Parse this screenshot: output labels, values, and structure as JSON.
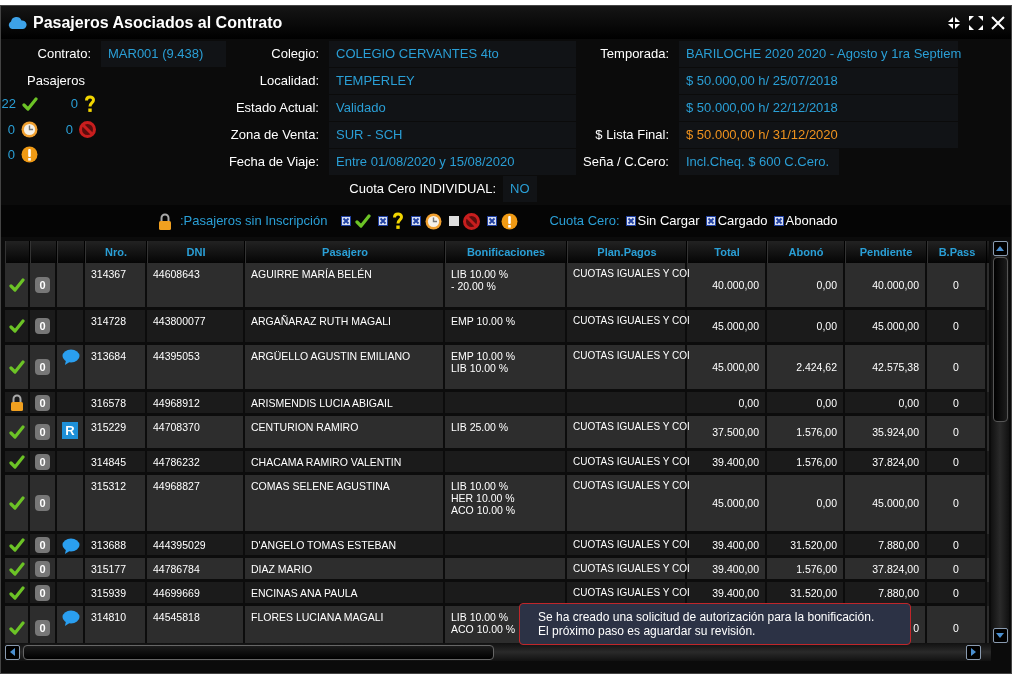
{
  "window": {
    "title": "Pasajeros Asociados al Contrato"
  },
  "contract": {
    "label": "Contrato:",
    "value": "MAR001 (9.438)"
  },
  "passenger_counts": {
    "title": "Pasajeros",
    "items": [
      {
        "kind": "ok",
        "count": "22"
      },
      {
        "kind": "pending",
        "count": "0"
      },
      {
        "kind": "waiting",
        "count": "0"
      },
      {
        "kind": "blocked",
        "count": "0"
      },
      {
        "kind": "alert",
        "count": "0"
      }
    ]
  },
  "info_middle": [
    {
      "label": "Colegio:",
      "value": "COLEGIO CERVANTES 4to"
    },
    {
      "label": "Localidad:",
      "value": "TEMPERLEY"
    },
    {
      "label": "Estado Actual:",
      "value": "Validado"
    },
    {
      "label": "Zona de Venta:",
      "value": "SUR - SCH"
    },
    {
      "label": "Fecha de Viaje:",
      "value": "Entre 01/08/2020 y 15/08/2020"
    }
  ],
  "info_right": [
    {
      "label": "Temporada:",
      "value": "BARILOCHE 2020 2020 - Agosto y 1ra Septiem",
      "highlight": false
    },
    {
      "value": "$ 50.000,00 h/ 25/07/2018",
      "highlight": false
    },
    {
      "value": "$ 50.000,00 h/ 22/12/2018",
      "highlight": false
    },
    {
      "label": "$ Lista Final:",
      "value": "$ 50.000,00 h/ 31/12/2020",
      "highlight": true
    },
    {
      "label": "Seña / C.Cero:",
      "value": "Incl.Cheq. $ 600 C.Cero.",
      "highlight": false
    }
  ],
  "cuota_cero_individual": {
    "label": "Cuota Cero INDIVIDUAL:",
    "value": "NO"
  },
  "legend": {
    "lock_label": ":Pasajeros sin Inscripción",
    "filters": [
      {
        "kind": "ok",
        "checked": true
      },
      {
        "kind": "pending",
        "checked": true
      },
      {
        "kind": "waiting",
        "checked": true
      },
      {
        "kind": "blocked",
        "checked": false
      },
      {
        "kind": "alert",
        "checked": true
      }
    ],
    "cuota_cero": {
      "label": "Cuota Cero:",
      "options": [
        {
          "label": "Sin Cargar",
          "checked": true
        },
        {
          "label": "Cargado",
          "checked": true
        },
        {
          "label": "Abonado",
          "checked": true
        }
      ]
    }
  },
  "table": {
    "columns": [
      "Nro.",
      "DNI",
      "Pasajero",
      "Bonificaciones",
      "Plan.Pagos",
      "Total",
      "Abonó",
      "Pendiente",
      "B.Pass"
    ],
    "rows": [
      {
        "kind": "ok",
        "badge": "0",
        "nro": "314367",
        "dni": "44608643",
        "pasajero": "AGUIRRE MARÍA BELÉN",
        "bonificaciones": [
          "LIB 10.00 %",
          "- 20.00 %"
        ],
        "plan": "CUOTAS IGUALES Y COI",
        "total": "40.000,00",
        "abono": "0,00",
        "pendiente": "40.000,00",
        "bpass": "0"
      },
      {
        "kind": "ok",
        "badge": "0",
        "nro": "314728",
        "dni": "443800077",
        "pasajero": "ARGAÑARAZ RUTH MAGALI",
        "bonificaciones": [
          "EMP 10.00 %"
        ],
        "plan": "CUOTAS IGUALES Y COI",
        "total": "45.000,00",
        "abono": "0,00",
        "pendiente": "45.000,00",
        "bpass": "0"
      },
      {
        "kind": "ok",
        "badge": "0",
        "note": {
          "kind": "comment"
        },
        "nro": "313684",
        "dni": "44395053",
        "pasajero": "ARGÜELLO AGUSTIN EMILIANO",
        "bonificaciones": [
          "EMP 10.00 %",
          "LIB 10.00 %"
        ],
        "plan": "CUOTAS IGUALES Y COI",
        "total": "45.000,00",
        "abono": "2.424,62",
        "pendiente": "42.575,38",
        "bpass": "0"
      },
      {
        "kind": "locked",
        "badge": "0",
        "nro": "316578",
        "dni": "44968912",
        "pasajero": "ARISMENDIS LUCIA ABIGAIL",
        "total": "0,00",
        "abono": "0,00",
        "pendiente": "0,00",
        "bpass": "0"
      },
      {
        "kind": "ok",
        "badge": "0",
        "note": {
          "kind": "letter",
          "text": "R"
        },
        "nro": "315229",
        "dni": "44708370",
        "pasajero": "CENTURION RAMIRO",
        "bonificaciones": [
          "LIB 25.00 %"
        ],
        "plan": "CUOTAS IGUALES Y COI",
        "total": "37.500,00",
        "abono": "1.576,00",
        "pendiente": "35.924,00",
        "bpass": "0"
      },
      {
        "kind": "ok",
        "badge": "0",
        "nro": "314845",
        "dni": "44786232",
        "pasajero": "CHACAMA RAMIRO VALENTIN",
        "plan": "CUOTAS IGUALES Y COI",
        "total": "39.400,00",
        "abono": "1.576,00",
        "pendiente": "37.824,00",
        "bpass": "0"
      },
      {
        "kind": "ok",
        "badge": "0",
        "nro": "315312",
        "dni": "44968827",
        "pasajero": "COMAS SELENE AGUSTINA",
        "bonificaciones": [
          "LIB 10.00 %",
          "HER 10.00 %",
          "ACO 10.00 %"
        ],
        "plan": "CUOTAS IGUALES Y COI",
        "total": "45.000,00",
        "abono": "0,00",
        "pendiente": "45.000,00",
        "bpass": "0"
      },
      {
        "kind": "ok",
        "badge": "0",
        "note": {
          "kind": "comment"
        },
        "nro": "313688",
        "dni": "444395029",
        "pasajero": "D'ANGELO TOMAS ESTEBAN",
        "plan": "CUOTAS IGUALES Y COI",
        "total": "39.400,00",
        "abono": "31.520,00",
        "pendiente": "7.880,00",
        "bpass": "0"
      },
      {
        "kind": "ok",
        "badge": "0",
        "nro": "315177",
        "dni": "44786784",
        "pasajero": "DIAZ MARIO",
        "plan": "CUOTAS IGUALES Y COI",
        "total": "39.400,00",
        "abono": "1.576,00",
        "pendiente": "37.824,00",
        "bpass": "0"
      },
      {
        "kind": "ok",
        "badge": "0",
        "nro": "315939",
        "dni": "44699669",
        "pasajero": "ENCINAS ANA PAULA",
        "plan": "CUOTAS IGUALES Y COI",
        "total": "39.400,00",
        "abono": "31.520,00",
        "pendiente": "7.880,00",
        "bpass": "0"
      },
      {
        "kind": "ok",
        "badge": "0",
        "note": {
          "kind": "comment"
        },
        "nro": "314810",
        "dni": "44545818",
        "pasajero": "FLORES LUCIANA MAGALI",
        "bonificaciones": [
          "LIB 10.00 %",
          "ACO 10.00 %"
        ],
        "pendiente": "0",
        "bpass": "0"
      }
    ]
  },
  "toast": {
    "lines": [
      "Se ha creado una solicitud de autorización para la bonificación.",
      "El próximo paso es aguardar su revisión."
    ]
  }
}
